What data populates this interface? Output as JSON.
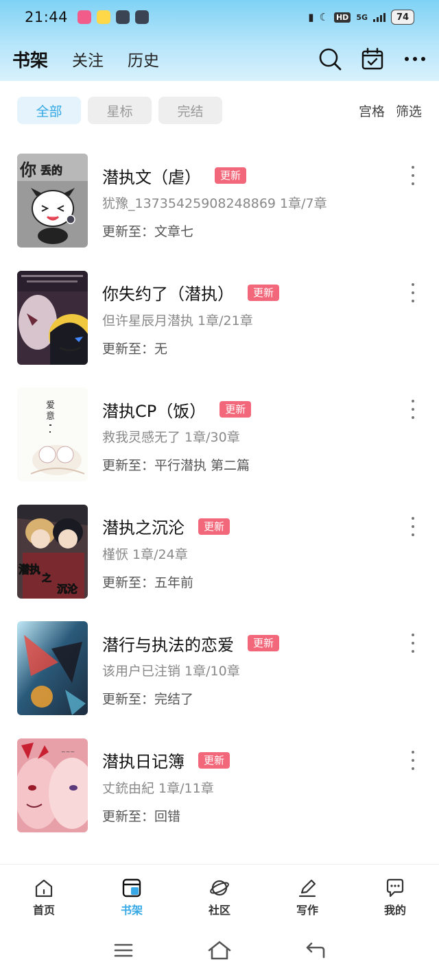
{
  "status_bar": {
    "time": "21:44",
    "hd_label": "HD",
    "network": "5G",
    "battery": "74"
  },
  "header": {
    "tabs": [
      {
        "label": "书架",
        "active": true
      },
      {
        "label": "关注",
        "active": false
      },
      {
        "label": "历史",
        "active": false
      }
    ],
    "icons": [
      "search-icon",
      "calendar-check-icon",
      "more-horizontal-icon"
    ]
  },
  "filters": {
    "chips": [
      {
        "label": "全部",
        "active": true
      },
      {
        "label": "星标",
        "active": false
      },
      {
        "label": "完结",
        "active": false
      }
    ],
    "grid_label": "宫格",
    "filter_label": "筛选"
  },
  "colors": {
    "accent": "#36a9e6",
    "badge": "#f2687a",
    "header_gradient_top": "#7fd2f5"
  },
  "books": [
    {
      "title": "潜执文（虐）",
      "badge": "更新",
      "author_progress": "犹豫_13735425908248869  1章/7章",
      "update": "更新至：文章七"
    },
    {
      "title": "你失约了（潜执）",
      "badge": "更新",
      "author_progress": "但许星辰月潜执  1章/21章",
      "update": "更新至：无"
    },
    {
      "title": "潜执CP（饭）",
      "badge": "更新",
      "author_progress": "救我灵感无了  1章/30章",
      "update": "更新至：平行潜执  第二篇"
    },
    {
      "title": "潜执之沉沦",
      "badge": "更新",
      "author_progress": "槿恹  1章/24章",
      "update": "更新至：五年前"
    },
    {
      "title": "潜行与执法的恋爱",
      "badge": "更新",
      "author_progress": "该用户已注销  1章/10章",
      "update": "更新至：完结了"
    },
    {
      "title": "潜执日记簿",
      "badge": "更新",
      "author_progress": "丈銃由紀  1章/11章",
      "update": "更新至：回错"
    }
  ],
  "bottom_nav": [
    {
      "label": "首页",
      "icon": "home-icon",
      "active": false
    },
    {
      "label": "书架",
      "icon": "bookshelf-icon",
      "active": true
    },
    {
      "label": "社区",
      "icon": "planet-icon",
      "active": false
    },
    {
      "label": "写作",
      "icon": "pen-icon",
      "active": false
    },
    {
      "label": "我的",
      "icon": "chat-bubble-icon",
      "active": false
    }
  ],
  "system_nav": [
    "menu-icon",
    "home-outline-icon",
    "back-icon"
  ]
}
